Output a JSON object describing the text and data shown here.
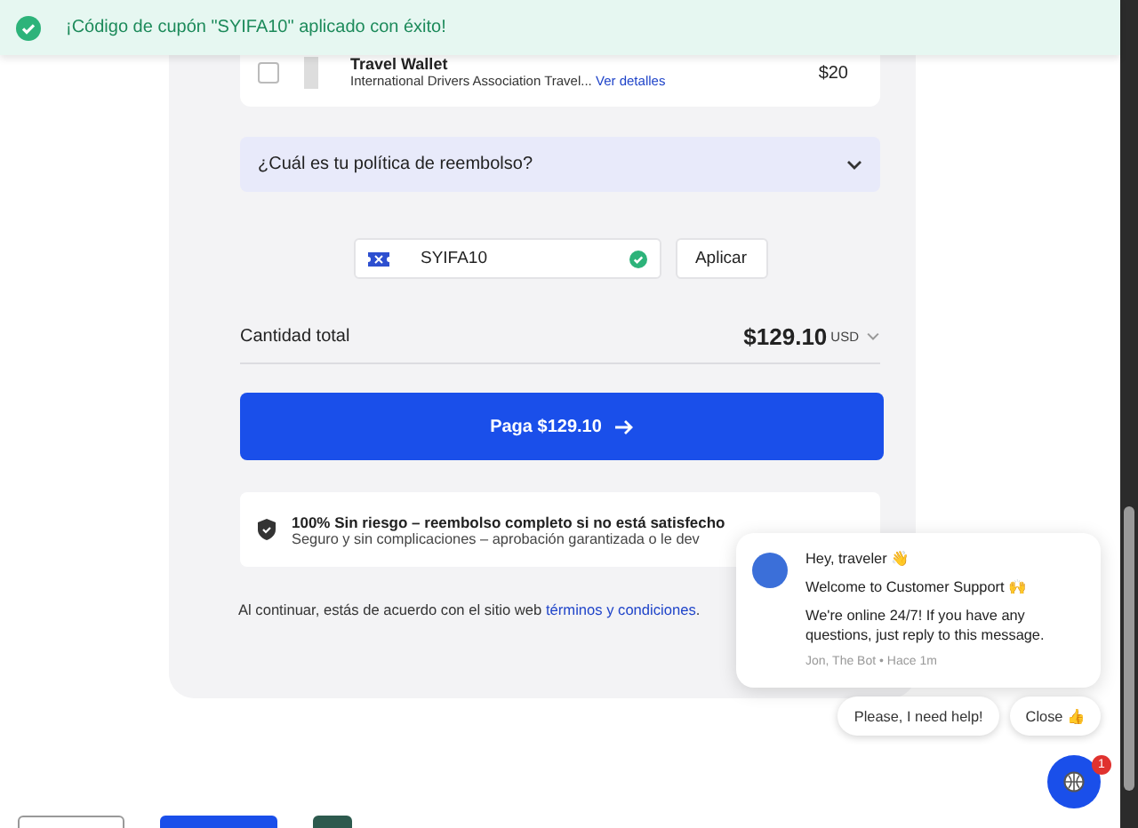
{
  "toast": {
    "message": "¡Código de cupón \"SYIFA10\" aplicado con éxito!"
  },
  "addon": {
    "checked": false,
    "title": "Travel Wallet",
    "description": "International Drivers Association Travel...",
    "link": "Ver detalles",
    "price": "$20"
  },
  "faq": {
    "question": "¿Cuál es tu política de reembolso?",
    "expanded": false
  },
  "coupon": {
    "value": "SYIFA10",
    "valid": true,
    "button": "Aplicar"
  },
  "total": {
    "label": "Cantidad total",
    "amount": "$129.10",
    "currency": "USD"
  },
  "pay_button": "Paga $129.10",
  "guarantee": {
    "title": "100% Sin riesgo – reembolso completo si no está satisfecho",
    "text": "Seguro y sin complicaciones – aprobación garantizada o le dev"
  },
  "agreement": {
    "text": "Al continuar, estás de acuerdo con el sitio web",
    "link": "términos y condiciones",
    "end": "."
  },
  "chat": {
    "greeting": "Hey, traveler 👋",
    "welcome": "Welcome to Customer Support 🙌",
    "body": "We're online 24/7! If you have any questions, just reply to this message.",
    "meta": "Jon, The Bot • Hace 1m",
    "replies": [
      "Please, I need help!",
      "Close 👍"
    ],
    "badge": "1"
  }
}
